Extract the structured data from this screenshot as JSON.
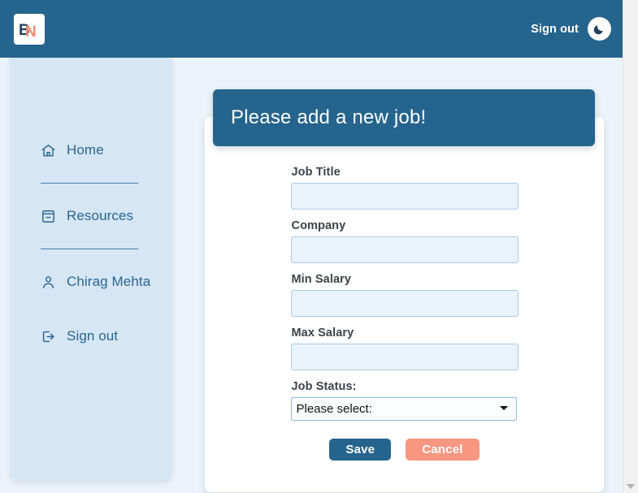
{
  "topnav": {
    "logo_icon": "brand-logo-bn",
    "logo_letters": {
      "b": "B",
      "n": "N"
    },
    "signout_label": "Sign out",
    "theme_toggle_icon": "moon-icon"
  },
  "sidebar": {
    "items": [
      {
        "label": "Home",
        "icon": "home-icon"
      },
      {
        "label": "Resources",
        "icon": "archive-icon"
      },
      {
        "label": "Chirag Mehta",
        "icon": "user-icon"
      },
      {
        "label": "Sign out",
        "icon": "sign-out-icon"
      }
    ]
  },
  "card": {
    "title": "Please add a new job!",
    "fields": [
      {
        "label": "Job Title",
        "value": "",
        "placeholder": ""
      },
      {
        "label": "Company",
        "value": "",
        "placeholder": ""
      },
      {
        "label": "Min Salary",
        "value": "",
        "placeholder": ""
      },
      {
        "label": "Max Salary",
        "value": "",
        "placeholder": ""
      }
    ],
    "status": {
      "label": "Job Status:",
      "selected": "Please select:",
      "options": [
        "Please select:"
      ]
    },
    "buttons": {
      "save_label": "Save",
      "cancel_label": "Cancel"
    }
  },
  "colors": {
    "nav_blue": "#25648c",
    "sidebar_blue": "#d6e6f5",
    "page_bg": "#ecf2f9",
    "accent_salmon": "#f79780",
    "input_bg": "#eaf2fb",
    "input_border": "#a8cbe8",
    "label_text": "#3d4349"
  }
}
